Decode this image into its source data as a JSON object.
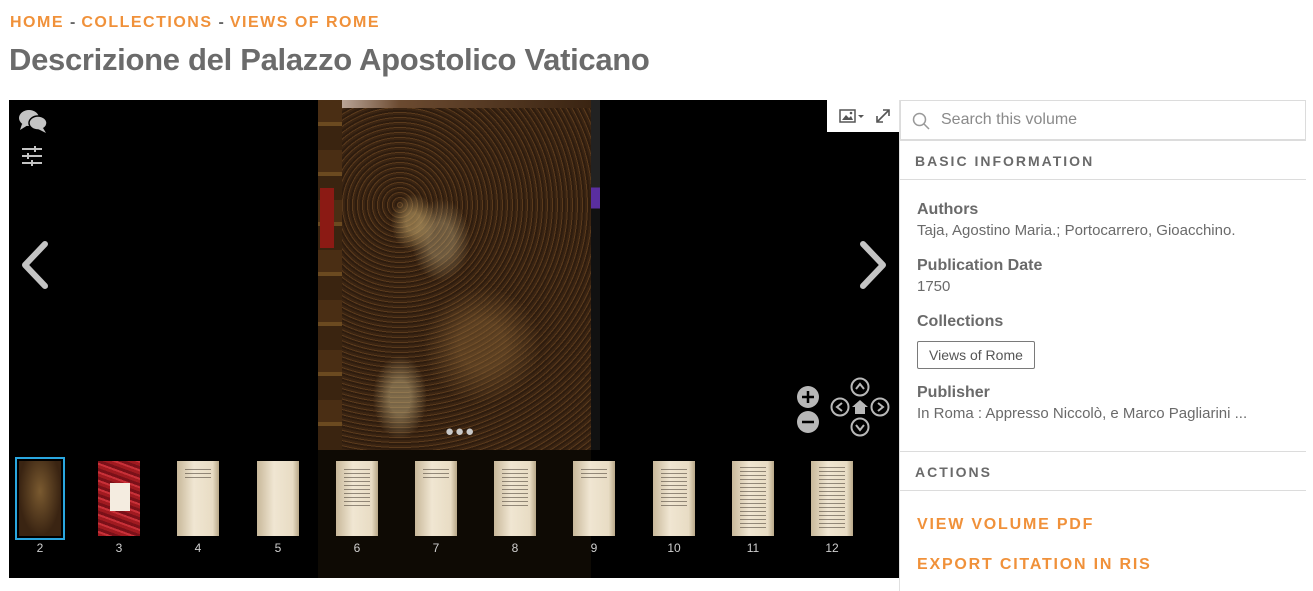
{
  "breadcrumb": {
    "home": "HOME",
    "collections": "COLLECTIONS",
    "current": "VIEWS OF ROME",
    "separator": "-"
  },
  "page_title": "Descrizione del Palazzo Apostolico Vaticano",
  "viewer": {
    "page_dots": "●●●",
    "thumbnails": [
      {
        "num": "2",
        "style": "cover",
        "selected": true
      },
      {
        "num": "3",
        "style": "red",
        "selected": false
      },
      {
        "num": "4",
        "style": "short",
        "selected": false
      },
      {
        "num": "5",
        "style": "blank",
        "selected": false
      },
      {
        "num": "6",
        "style": "mid",
        "selected": false
      },
      {
        "num": "7",
        "style": "short",
        "selected": false
      },
      {
        "num": "8",
        "style": "mid",
        "selected": false
      },
      {
        "num": "9",
        "style": "short",
        "selected": false
      },
      {
        "num": "10",
        "style": "mid",
        "selected": false
      },
      {
        "num": "11",
        "style": "full",
        "selected": false
      },
      {
        "num": "12",
        "style": "full",
        "selected": false
      }
    ]
  },
  "sidebar": {
    "search_placeholder": "Search this volume",
    "basic_info_header": "BASIC INFORMATION",
    "authors_label": "Authors",
    "authors_value": "Taja, Agostino Maria.; Portocarrero, Gioacchino.",
    "pubdate_label": "Publication Date",
    "pubdate_value": "1750",
    "collections_label": "Collections",
    "collection_button": "Views of Rome",
    "publisher_label": "Publisher",
    "publisher_value": "In Roma : Appresso Niccolò, e Marco Pagliarini ...",
    "actions_header": "ACTIONS",
    "action_pdf": "VIEW VOLUME PDF",
    "action_ris": "EXPORT CITATION IN RIS"
  },
  "colors": {
    "accent": "#f0913a",
    "text": "#6a6a6a",
    "viewer_bg": "#000000",
    "selected_thumb": "#2aa7e0"
  }
}
